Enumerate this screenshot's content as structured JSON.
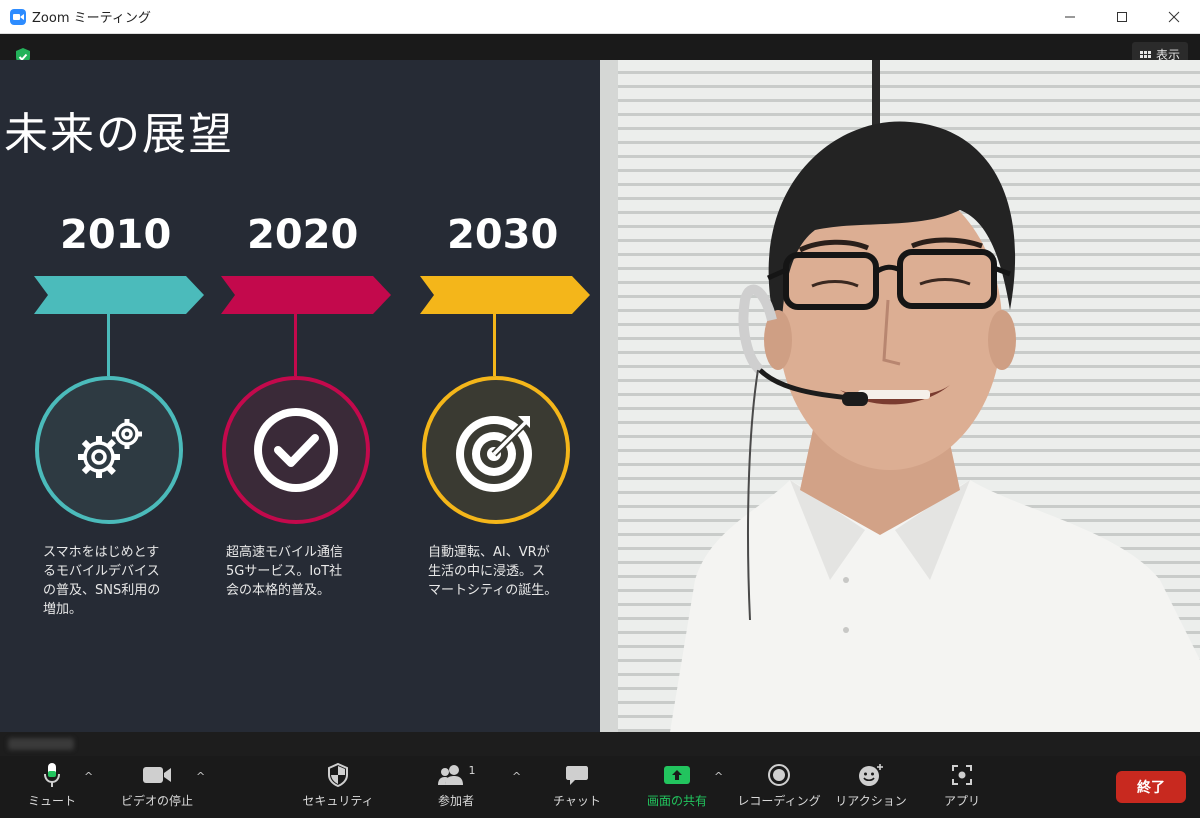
{
  "window": {
    "title": "Zoom ミーティング",
    "minimize": "—",
    "maximize": "☐",
    "close": "✕"
  },
  "view_button": {
    "label": "表示"
  },
  "slide": {
    "title": "未来の展望",
    "timeline": [
      {
        "year": "2010",
        "color": "#4bbbbb",
        "icon": "gears-icon",
        "text": [
          "スマホをはじめとす",
          "るモバイルデバイス",
          "の普及、SNS利用の",
          "増加。"
        ]
      },
      {
        "year": "2020",
        "color": "#c3094c",
        "icon": "check-icon",
        "text": [
          "超高速モバイル通信",
          "5Gサービス。IoT社",
          "会の本格的普及。"
        ]
      },
      {
        "year": "2030",
        "color": "#f4b61a",
        "icon": "target-icon",
        "text": [
          "自動運転、AI、VRが",
          "生活の中に浸透。ス",
          "マートシティの誕生。"
        ]
      }
    ]
  },
  "toolbar": {
    "mute": "ミュート",
    "video": "ビデオの停止",
    "security": "セキュリティ",
    "participants": "参加者",
    "participant_count": "1",
    "chat": "チャット",
    "share": "画面の共有",
    "record": "レコーディング",
    "reactions": "リアクション",
    "apps": "アプリ",
    "end": "終了",
    "share_color": "#22c45e"
  }
}
